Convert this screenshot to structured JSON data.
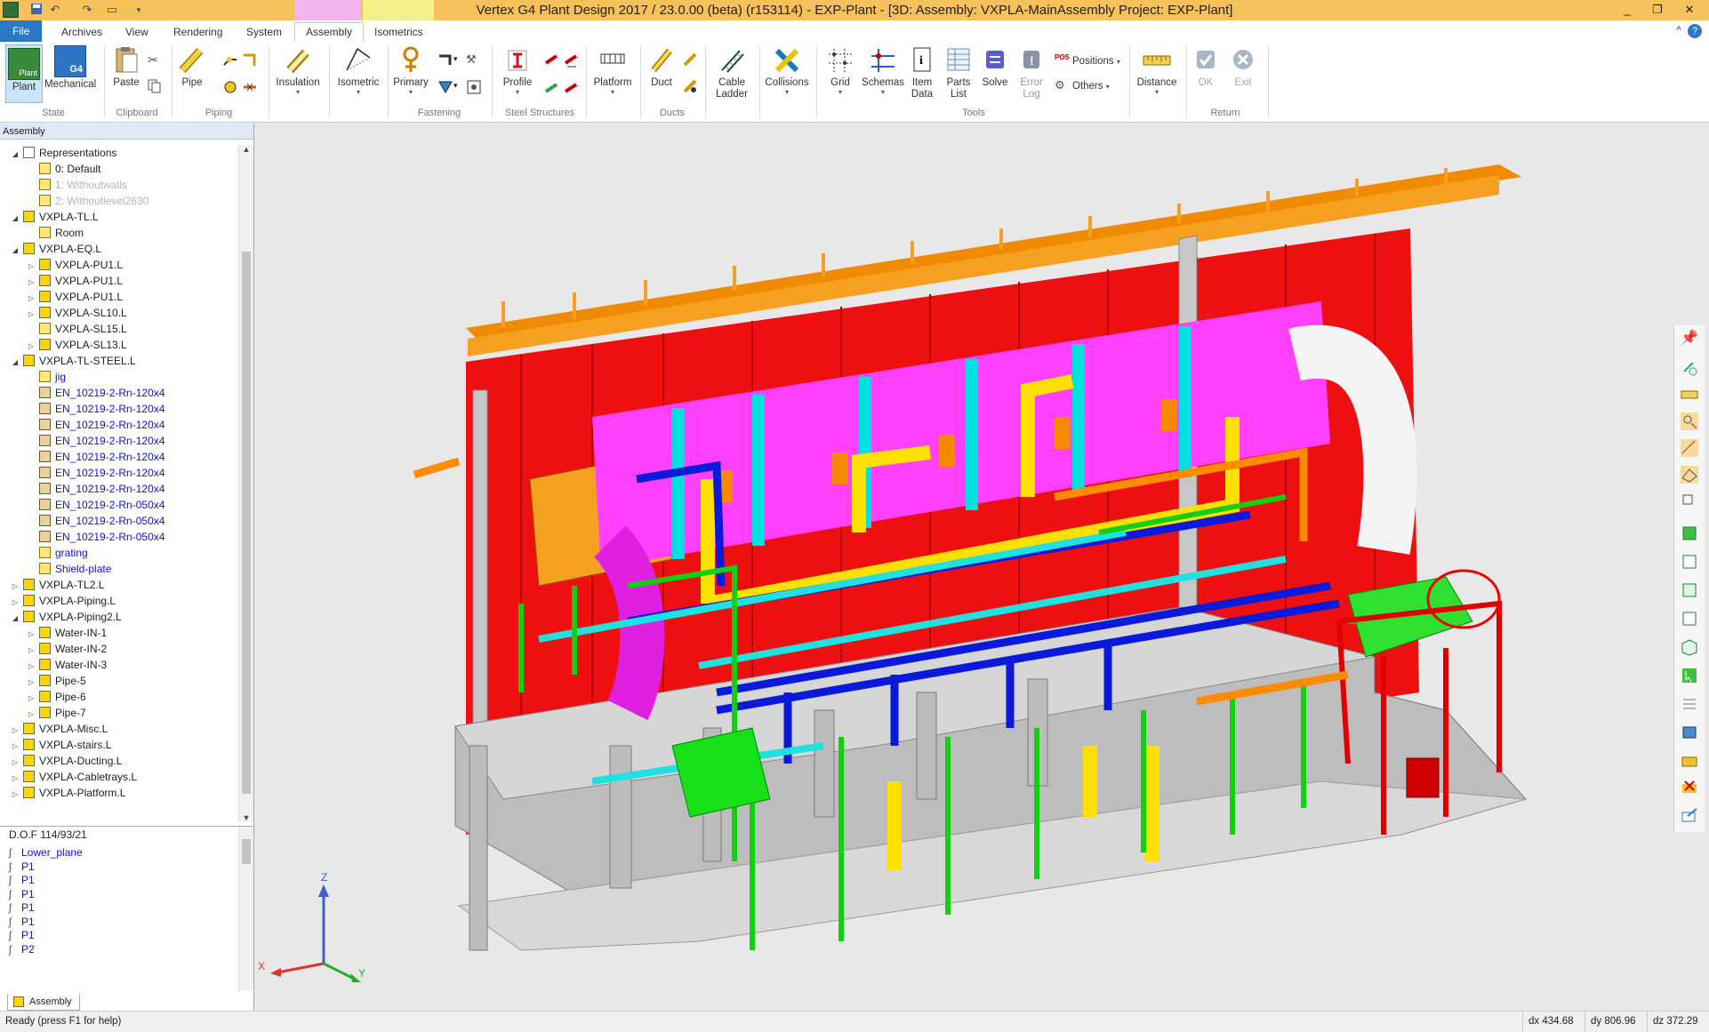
{
  "window": {
    "title": "Vertex G4 Plant Design 2017 / 23.0.00 (beta) (r153114) - EXP-Plant - [3D: Assembly: VXPLA-MainAssembly  Project: EXP-Plant]",
    "controls": [
      "_",
      "❐",
      "✕"
    ],
    "inner_controls": [
      "_",
      "❐",
      "✕"
    ],
    "help": "?",
    "collapse": "^"
  },
  "quick_access": [
    "save-icon",
    "undo-icon",
    "redo-icon",
    "window-icon",
    "customize-icon"
  ],
  "tabs": [
    "File",
    "Archives",
    "View",
    "Rendering",
    "System",
    "Assembly",
    "Isometrics"
  ],
  "active_tab": "Assembly",
  "ribbon": {
    "state": {
      "group": "State",
      "plant": "Plant",
      "mechanical": "Mechanical",
      "g4": "G4",
      "plant_badge": "Plant"
    },
    "clipboard": {
      "group": "Clipboard",
      "paste": "Paste"
    },
    "piping": {
      "group": "Piping",
      "pipe": "Pipe"
    },
    "insulation": "Insulation",
    "isometric": "Isometric",
    "fastening": {
      "group": "Fastening",
      "primary": "Primary"
    },
    "steel": {
      "group": "Steel Structures",
      "profile": "Profile"
    },
    "platform": "Platform",
    "ducts": {
      "group": "Ducts",
      "duct": "Duct"
    },
    "cable_ladder": [
      "Cable",
      "Ladder"
    ],
    "collisions": "Collisions",
    "tools": {
      "group": "Tools",
      "grid": "Grid",
      "schemas": "Schemas",
      "item_data": [
        "Item",
        "Data"
      ],
      "parts_list": [
        "Parts",
        "List"
      ],
      "solve": "Solve",
      "error_log": [
        "Error",
        "Log"
      ],
      "positions": "Positions",
      "positions_badge": "POS",
      "others": "Others"
    },
    "distance": "Distance",
    "return": {
      "group": "Return",
      "ok": "OK",
      "exit": "Exit"
    }
  },
  "panel": {
    "header": "Assembly",
    "tree": [
      {
        "label": "Representations",
        "level": 0,
        "exp": "◢",
        "icon": "rep",
        "style": ""
      },
      {
        "label": "0: Default",
        "level": 1,
        "exp": "",
        "icon": "part",
        "style": ""
      },
      {
        "label": "1: Withoutwalls",
        "level": 1,
        "exp": "",
        "icon": "part",
        "style": "grey"
      },
      {
        "label": "2: Withoutlevel2630",
        "level": 1,
        "exp": "",
        "icon": "part",
        "style": "grey"
      },
      {
        "label": "VXPLA-TL.L",
        "level": 0,
        "exp": "◢",
        "icon": "asm",
        "style": ""
      },
      {
        "label": "Room",
        "level": 1,
        "exp": "",
        "icon": "part",
        "style": ""
      },
      {
        "label": "VXPLA-EQ.L",
        "level": 0,
        "exp": "◢",
        "icon": "asm",
        "style": ""
      },
      {
        "label": "VXPLA-PU1.L",
        "level": 1,
        "exp": "▷",
        "icon": "asm",
        "style": ""
      },
      {
        "label": "VXPLA-PU1.L",
        "level": 1,
        "exp": "▷",
        "icon": "asm",
        "style": ""
      },
      {
        "label": "VXPLA-PU1.L",
        "level": 1,
        "exp": "▷",
        "icon": "asm",
        "style": ""
      },
      {
        "label": "VXPLA-SL10.L",
        "level": 1,
        "exp": "▷",
        "icon": "asm",
        "style": ""
      },
      {
        "label": "VXPLA-SL15.L",
        "level": 1,
        "exp": "",
        "icon": "part",
        "style": ""
      },
      {
        "label": "VXPLA-SL13.L",
        "level": 1,
        "exp": "▷",
        "icon": "asm",
        "style": ""
      },
      {
        "label": "VXPLA-TL-STEEL.L",
        "level": 0,
        "exp": "◢",
        "icon": "asm",
        "style": ""
      },
      {
        "label": "jig",
        "level": 1,
        "exp": "",
        "icon": "part",
        "style": "blue"
      },
      {
        "label": "EN_10219-2-Rn-120x4",
        "level": 1,
        "exp": "",
        "icon": "stl",
        "style": "blue"
      },
      {
        "label": "EN_10219-2-Rn-120x4",
        "level": 1,
        "exp": "",
        "icon": "stl",
        "style": "blue"
      },
      {
        "label": "EN_10219-2-Rn-120x4",
        "level": 1,
        "exp": "",
        "icon": "stl",
        "style": "blue"
      },
      {
        "label": "EN_10219-2-Rn-120x4",
        "level": 1,
        "exp": "",
        "icon": "stl",
        "style": "blue"
      },
      {
        "label": "EN_10219-2-Rn-120x4",
        "level": 1,
        "exp": "",
        "icon": "stl",
        "style": "blue"
      },
      {
        "label": "EN_10219-2-Rn-120x4",
        "level": 1,
        "exp": "",
        "icon": "stl",
        "style": "blue"
      },
      {
        "label": "EN_10219-2-Rn-120x4",
        "level": 1,
        "exp": "",
        "icon": "stl",
        "style": "blue"
      },
      {
        "label": "EN_10219-2-Rn-050x4",
        "level": 1,
        "exp": "",
        "icon": "stl",
        "style": "blue"
      },
      {
        "label": "EN_10219-2-Rn-050x4",
        "level": 1,
        "exp": "",
        "icon": "stl",
        "style": "blue"
      },
      {
        "label": "EN_10219-2-Rn-050x4",
        "level": 1,
        "exp": "",
        "icon": "stl",
        "style": "blue"
      },
      {
        "label": "grating",
        "level": 1,
        "exp": "",
        "icon": "part",
        "style": "blue"
      },
      {
        "label": "Shield-plate",
        "level": 1,
        "exp": "",
        "icon": "part",
        "style": "blue"
      },
      {
        "label": "VXPLA-TL2.L",
        "level": 0,
        "exp": "▷",
        "icon": "asm",
        "style": ""
      },
      {
        "label": "VXPLA-Piping.L",
        "level": 0,
        "exp": "▷",
        "icon": "asm",
        "style": ""
      },
      {
        "label": "VXPLA-Piping2.L",
        "level": 0,
        "exp": "◢",
        "icon": "asm",
        "style": ""
      },
      {
        "label": "Water-IN-1",
        "level": 1,
        "exp": "▷",
        "icon": "asm",
        "style": ""
      },
      {
        "label": "Water-IN-2",
        "level": 1,
        "exp": "▷",
        "icon": "asm",
        "style": ""
      },
      {
        "label": "Water-IN-3",
        "level": 1,
        "exp": "▷",
        "icon": "asm",
        "style": ""
      },
      {
        "label": "Pipe-5",
        "level": 1,
        "exp": "▷",
        "icon": "asm",
        "style": ""
      },
      {
        "label": "Pipe-6",
        "level": 1,
        "exp": "▷",
        "icon": "asm",
        "style": ""
      },
      {
        "label": "Pipe-7",
        "level": 1,
        "exp": "▷",
        "icon": "asm",
        "style": ""
      },
      {
        "label": "VXPLA-Misc.L",
        "level": 0,
        "exp": "▷",
        "icon": "asm",
        "style": ""
      },
      {
        "label": "VXPLA-stairs.L",
        "level": 0,
        "exp": "▷",
        "icon": "asm",
        "style": ""
      },
      {
        "label": "VXPLA-Ducting.L",
        "level": 0,
        "exp": "▷",
        "icon": "asm",
        "style": ""
      },
      {
        "label": "VXPLA-Cabletrays.L",
        "level": 0,
        "exp": "▷",
        "icon": "asm",
        "style": ""
      },
      {
        "label": "VXPLA-Platform.L",
        "level": 0,
        "exp": "▷",
        "icon": "asm",
        "style": ""
      }
    ],
    "dof_header": "D.O.F  114/93/21",
    "dof_items": [
      "Lower_plane",
      "P1",
      "P1",
      "P1",
      "P1",
      "P1",
      "P1",
      "P2"
    ],
    "bottom_tab": "Assembly"
  },
  "axes": {
    "z": "Z",
    "x": "X",
    "y": "Y"
  },
  "status": {
    "message": "Ready (press F1 for help)",
    "dx": "dx 434.68",
    "dy": "dy 806.96",
    "dz": "dz 372.29"
  }
}
